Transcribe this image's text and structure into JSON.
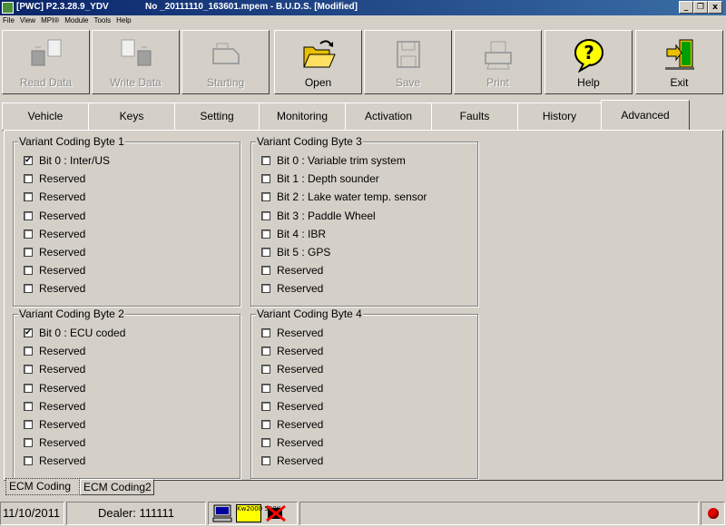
{
  "window": {
    "title_left": "[PWC] P2.3.28.9_YDV",
    "title_file": "No _20111110_163601.mpem - B.U.D.S. [Modified]",
    "controls": [
      "_",
      "й",
      "x"
    ]
  },
  "menu": [
    "File",
    "View",
    "MPI®",
    "Module",
    "Tools",
    "Help"
  ],
  "toolbar": {
    "buttons": [
      {
        "label": "Read Data",
        "icon": "read-data-icon",
        "enabled": false
      },
      {
        "label": "Write Data",
        "icon": "write-data-icon",
        "enabled": false
      },
      {
        "label": "Starting",
        "icon": "engine-icon",
        "enabled": false
      },
      {
        "label": "Open",
        "icon": "open-folder-icon",
        "enabled": true
      },
      {
        "label": "Save",
        "icon": "floppy-disk-icon",
        "enabled": false
      },
      {
        "label": "Print",
        "icon": "printer-icon",
        "enabled": false
      },
      {
        "label": "Help",
        "icon": "help-bubble-icon",
        "enabled": true
      },
      {
        "label": "Exit",
        "icon": "exit-door-icon",
        "enabled": true
      }
    ]
  },
  "tabs": [
    "Vehicle",
    "Keys",
    "Setting",
    "Monitoring",
    "Activation",
    "Faults",
    "History",
    "Advanced"
  ],
  "active_tab": "Advanced",
  "groups": [
    {
      "title": "Variant Coding Byte 1",
      "items": [
        {
          "label": "Bit 0 : Inter/US",
          "checked": true
        },
        {
          "label": "Reserved",
          "checked": false
        },
        {
          "label": "Reserved",
          "checked": false
        },
        {
          "label": "Reserved",
          "checked": false
        },
        {
          "label": "Reserved",
          "checked": false
        },
        {
          "label": "Reserved",
          "checked": false
        },
        {
          "label": "Reserved",
          "checked": false
        },
        {
          "label": "Reserved",
          "checked": false
        }
      ]
    },
    {
      "title": "Variant Coding Byte 3",
      "items": [
        {
          "label": "Bit 0 : Variable trim system",
          "checked": false
        },
        {
          "label": "Bit 1 : Depth sounder",
          "checked": false
        },
        {
          "label": "Bit 2 : Lake water temp. sensor",
          "checked": false
        },
        {
          "label": "Bit 3 : Paddle Wheel",
          "checked": false
        },
        {
          "label": "Bit 4 : IBR",
          "checked": false
        },
        {
          "label": "Bit 5 : GPS",
          "checked": false
        },
        {
          "label": "Reserved",
          "checked": false
        },
        {
          "label": "Reserved",
          "checked": false
        }
      ]
    },
    {
      "title": "Variant Coding Byte 2",
      "items": [
        {
          "label": "Bit 0 : ECU coded",
          "checked": true
        },
        {
          "label": "Reserved",
          "checked": false
        },
        {
          "label": "Reserved",
          "checked": false
        },
        {
          "label": "Reserved",
          "checked": false
        },
        {
          "label": "Reserved",
          "checked": false
        },
        {
          "label": "Reserved",
          "checked": false
        },
        {
          "label": "Reserved",
          "checked": false
        },
        {
          "label": "Reserved",
          "checked": false
        }
      ]
    },
    {
      "title": "Variant Coding Byte 4",
      "items": [
        {
          "label": "Reserved",
          "checked": false
        },
        {
          "label": "Reserved",
          "checked": false
        },
        {
          "label": "Reserved",
          "checked": false
        },
        {
          "label": "Reserved",
          "checked": false
        },
        {
          "label": "Reserved",
          "checked": false
        },
        {
          "label": "Reserved",
          "checked": false
        },
        {
          "label": "Reserved",
          "checked": false
        },
        {
          "label": "Reserved",
          "checked": false
        }
      ]
    }
  ],
  "subtabs": [
    "ECM Coding",
    "ECM Coding2"
  ],
  "active_subtab": "ECM Coding",
  "status": {
    "date": "11/10/2011",
    "dealer": "Dealer: 111111",
    "indicator_text": "Kw2000 500K",
    "icons": [
      "computer-icon",
      "kwp2000-icon",
      "disconnected-icon",
      "status-led-icon"
    ],
    "led_color": "#e00000"
  }
}
